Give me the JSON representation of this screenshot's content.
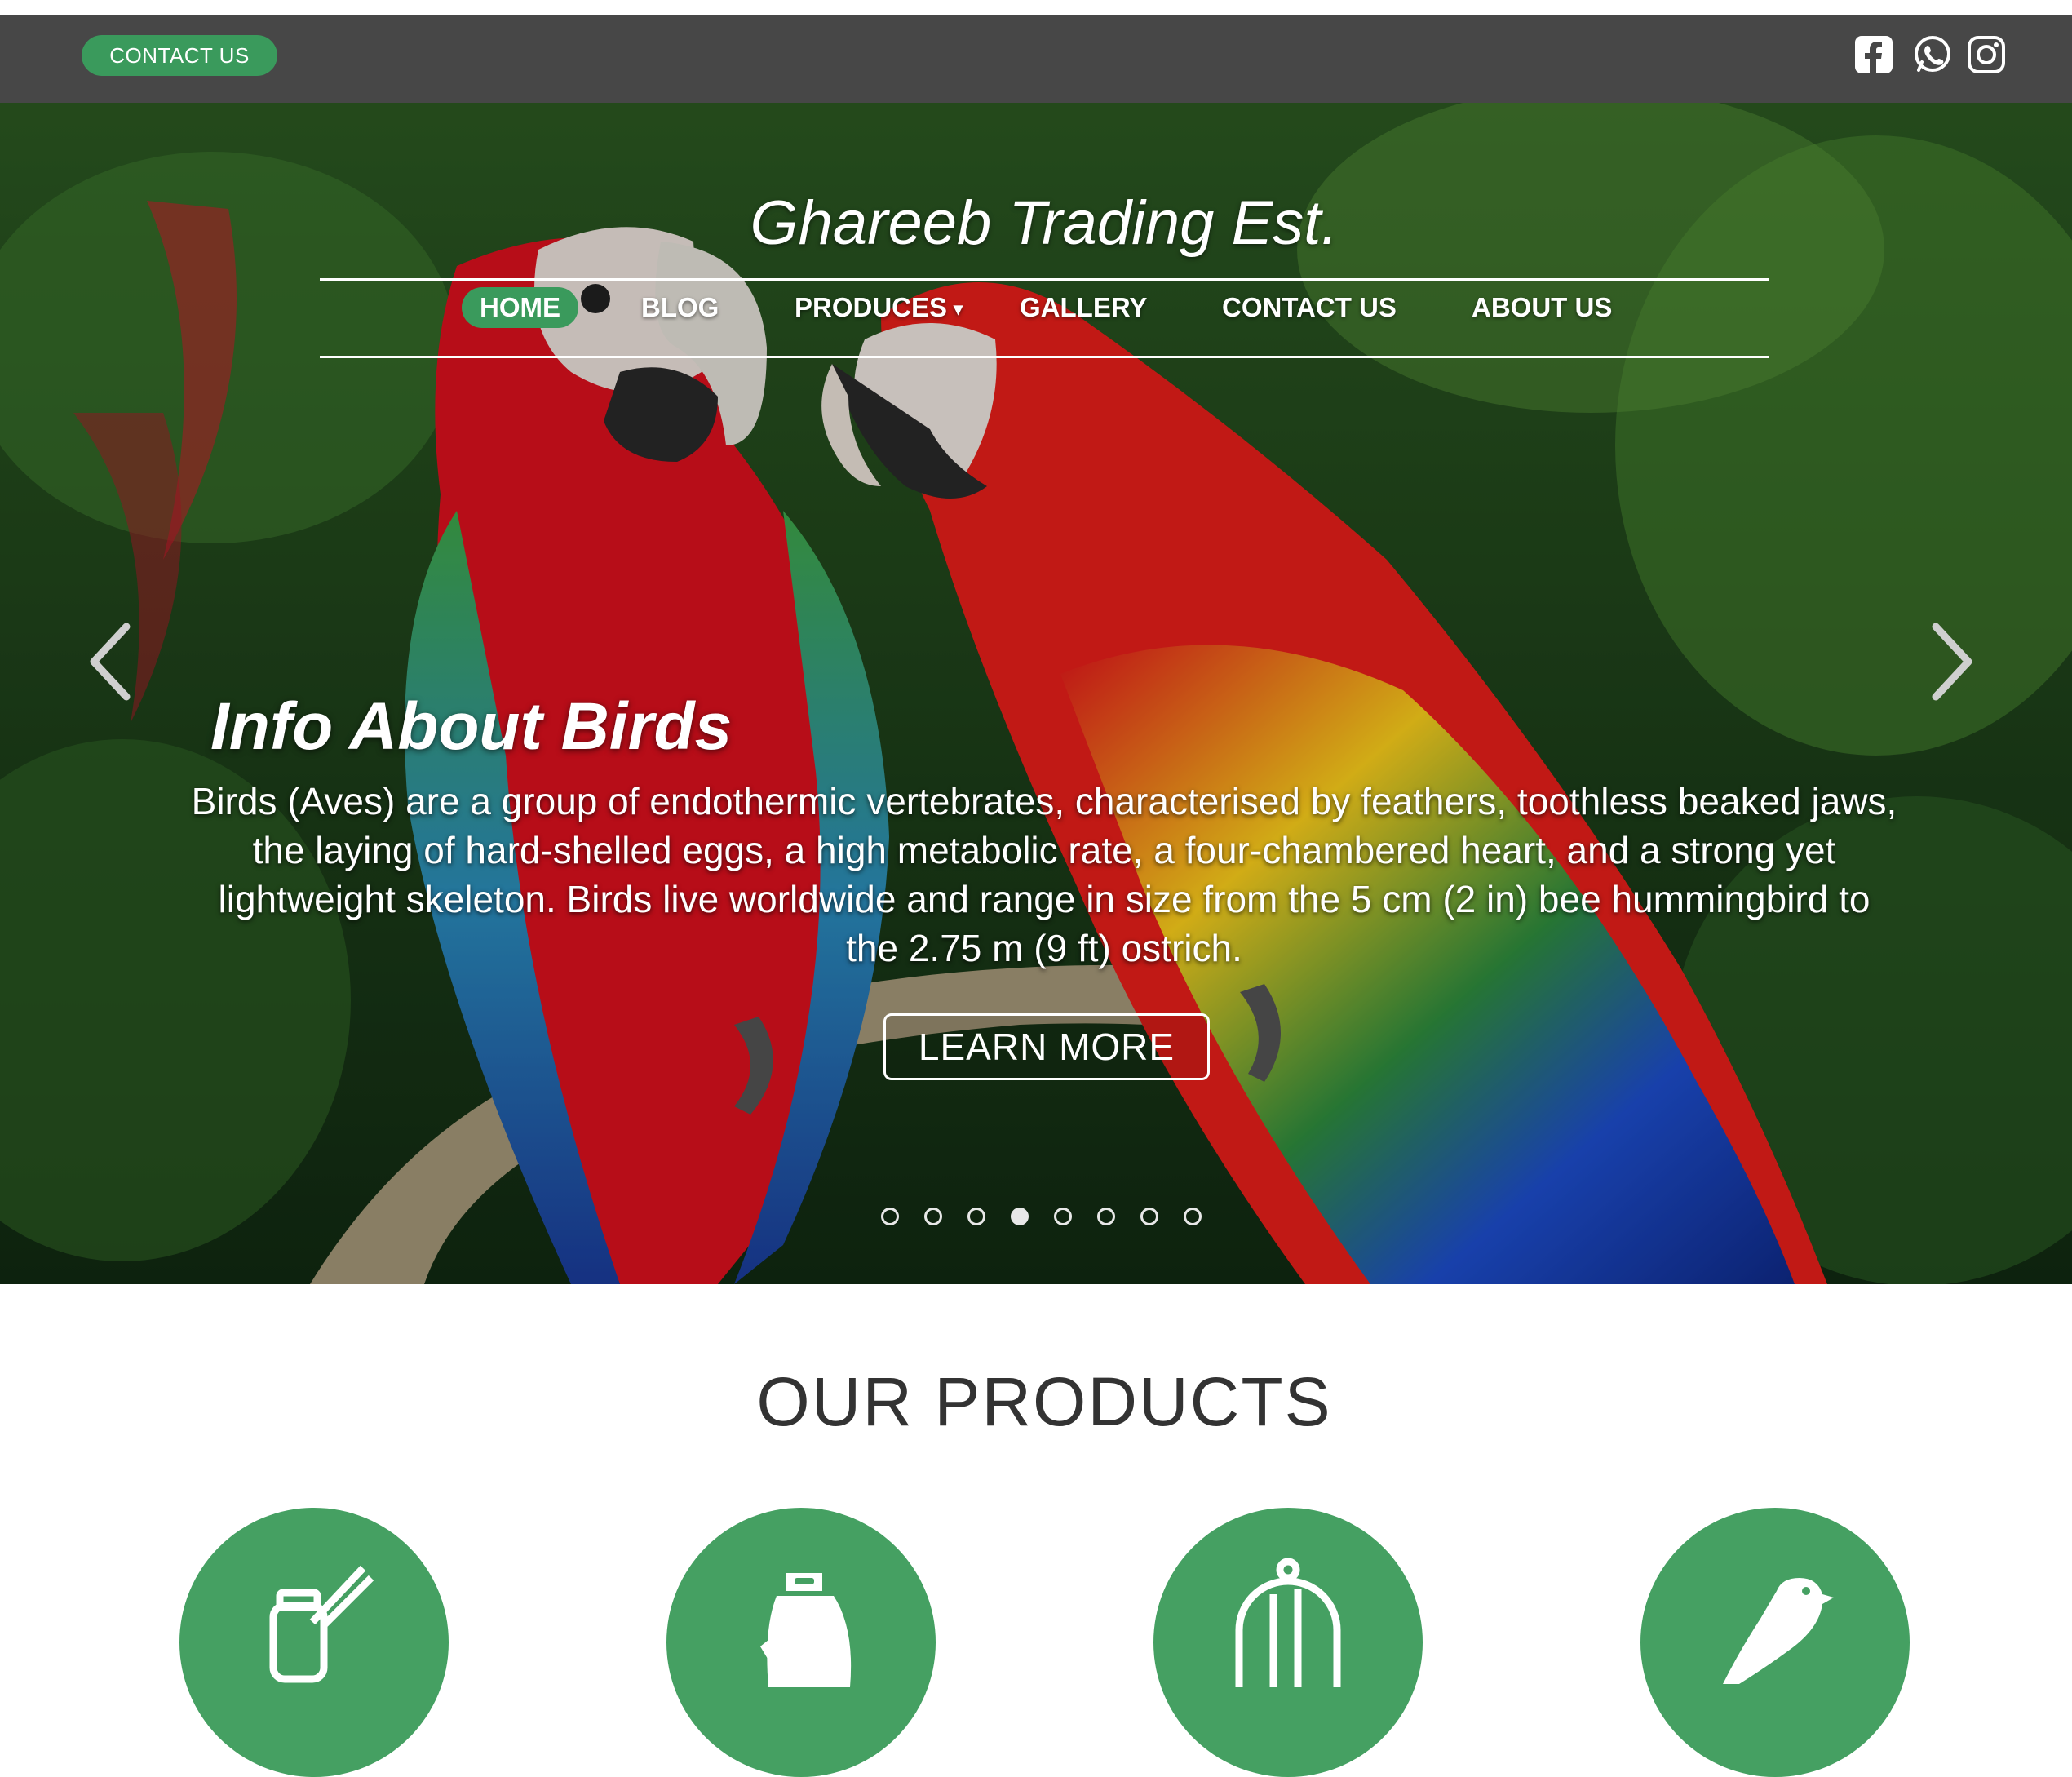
{
  "topbar": {
    "contact_label": "CONTACT US",
    "social": [
      {
        "icon": "facebook-icon"
      },
      {
        "icon": "whatsapp-icon"
      },
      {
        "icon": "instagram-icon"
      }
    ]
  },
  "brand": "Ghareeb Trading Est.",
  "nav": {
    "items": [
      {
        "label": "HOME",
        "active": true
      },
      {
        "label": "BLOG"
      },
      {
        "label": "PRODUCES",
        "dropdown": true
      },
      {
        "label": "GALLERY"
      },
      {
        "label": "CONTACT US"
      },
      {
        "label": "ABOUT US"
      }
    ],
    "dropdown_icon": "▾"
  },
  "slider": {
    "title": "Info About Birds",
    "text": "Birds (Aves) are a group of endothermic vertebrates, characterised by feathers, toothless beaked jaws, the laying of hard-shelled eggs, a high metabolic rate, a four-chambered heart, and a strong yet lightweight skeleton. Birds live worldwide and range in size from the 5 cm (2 in) bee hummingbird to the 2.75 m (9 ft) ostrich.",
    "button_label": "LEARN MORE",
    "slide_count": 8,
    "active_slide": 4,
    "prev_icon": "chevron-left-icon",
    "next_icon": "chevron-right-icon"
  },
  "products": {
    "title": "OUR PRODUCTS",
    "items": [
      {
        "icon": "honey-jar-icon"
      },
      {
        "icon": "feed-bag-icon"
      },
      {
        "icon": "bird-cage-icon"
      },
      {
        "icon": "bird-icon"
      }
    ]
  },
  "colors": {
    "accent_green": "#3a9a5c",
    "topbar": "#474747"
  }
}
